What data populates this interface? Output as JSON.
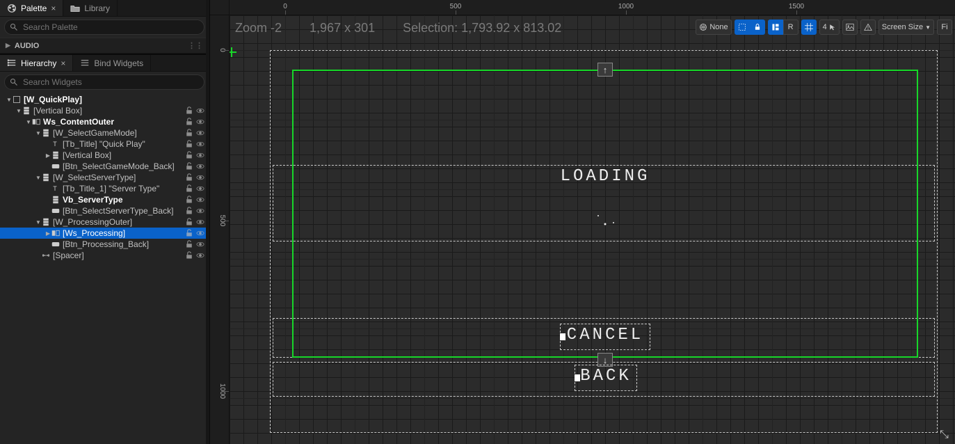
{
  "tabs_top": {
    "palette": "Palette",
    "library": "Library"
  },
  "search": {
    "palette_placeholder": "Search Palette",
    "widgets_placeholder": "Search Widgets"
  },
  "palette_section": "AUDIO",
  "tabs_mid": {
    "hierarchy": "Hierarchy",
    "bind": "Bind Widgets"
  },
  "tree": [
    {
      "d": 0,
      "a": "down",
      "ico": "root",
      "label": "[W_QuickPlay]",
      "bold": true,
      "eye": false
    },
    {
      "d": 1,
      "a": "down",
      "ico": "vbox",
      "label": "[Vertical Box]",
      "eye": true
    },
    {
      "d": 2,
      "a": "down",
      "ico": "switch",
      "label": "Ws_ContentOuter",
      "bold": true,
      "eye": true
    },
    {
      "d": 3,
      "a": "down",
      "ico": "vbox",
      "label": "[W_SelectGameMode]",
      "eye": true
    },
    {
      "d": 4,
      "a": "none",
      "ico": "text",
      "label": "[Tb_Title] \"Quick Play\"",
      "eye": true
    },
    {
      "d": 4,
      "a": "right",
      "ico": "vbox",
      "label": "[Vertical Box]",
      "eye": true
    },
    {
      "d": 4,
      "a": "none",
      "ico": "btn",
      "label": "[Btn_SelectGameMode_Back]",
      "eye": true
    },
    {
      "d": 3,
      "a": "down",
      "ico": "vbox",
      "label": "[W_SelectServerType]",
      "eye": true
    },
    {
      "d": 4,
      "a": "none",
      "ico": "text",
      "label": "[Tb_Title_1] \"Server Type\"",
      "eye": true
    },
    {
      "d": 4,
      "a": "none",
      "ico": "vbox",
      "label": "Vb_ServerType",
      "bold": true,
      "eye": true
    },
    {
      "d": 4,
      "a": "none",
      "ico": "btn",
      "label": "[Btn_SelectServerType_Back]",
      "eye": true
    },
    {
      "d": 3,
      "a": "down",
      "ico": "vbox",
      "label": "[W_ProcessingOuter]",
      "eye": true
    },
    {
      "d": 4,
      "a": "right",
      "ico": "switch",
      "label": "[Ws_Processing]",
      "eye": true,
      "selected": true
    },
    {
      "d": 4,
      "a": "none",
      "ico": "btn",
      "label": "[Btn_Processing_Back]",
      "eye": true
    },
    {
      "d": 3,
      "a": "none",
      "ico": "spacer",
      "label": "[Spacer]",
      "eye": true
    }
  ],
  "viewport": {
    "zoom_label": "Zoom -2",
    "dims_label": "1,967 x 301",
    "selection_label": "Selection: 1,793.92 x 813.02",
    "ruler_h": [
      0,
      500,
      1000,
      1500
    ],
    "ruler_v": [
      0,
      500,
      1000
    ],
    "loading_text": "LOADING",
    "cancel_text": "CANCEL",
    "back_text": "BACK",
    "anchor_up": "↑",
    "anchor_down": "↓"
  },
  "toolbar": {
    "lang": "None",
    "r": "R",
    "count": "4",
    "screen": "Screen Size",
    "fill": "Fi"
  }
}
